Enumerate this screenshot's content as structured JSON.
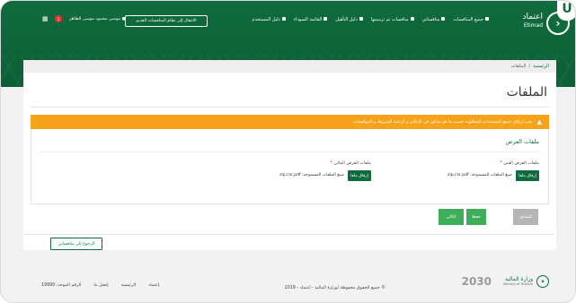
{
  "corner_badge": "U",
  "header": {
    "brand_ar": "اعتماد",
    "brand_en": "Etimad",
    "nav": [
      "جميع المنافسات",
      "منافساتي",
      "منافسات تم ترسيتها",
      "دليل التأهيل",
      "القائمة السوداء",
      "دليل المستخدم"
    ],
    "old_system_button": "الانتقال إلى نظام المنافسات القديم",
    "user_name": "موسى محمود موسى الظاهر",
    "notification_count": "1",
    "grid_icon": "grid-icon"
  },
  "breadcrumb": {
    "home": "الرئيسية",
    "separator": "/",
    "current": "الملفات"
  },
  "page_title": "الملفات",
  "alert": {
    "text": "يجب إرفاق جميع المستندات المطلوبة حسب ما هو مذكور في الإعلان و كراسة الشروط و المواصفات"
  },
  "panel": {
    "title": "ملفات العرض",
    "technical_label": "ملفات العرض الفني",
    "financial_label": "ملفات العرض المالي",
    "required_mark": "*",
    "attach_label": "إرفاق ملفا",
    "allowed_types": "صيغ الملفات المسموحة: zip,rar,pdf"
  },
  "wizard": {
    "prev": "السابق",
    "save": "حفظ",
    "next": "التالي"
  },
  "back_button": "الرجوع إلى منافساتي",
  "footer": {
    "ministry_ar": "وزارة المالية",
    "ministry_en": "Ministry of Finance",
    "vision": "2030",
    "copyright": "© جميع الحقوق محفوظة لوزارة المالية - اعتماد - 2019",
    "links": [
      "إعتماد",
      "الرئيسية",
      "إتصل بنا",
      "الرقم الموحد: 19990"
    ]
  },
  "colors": {
    "primary_green": "#0f6b3d",
    "warning_orange": "#f7a21b",
    "disabled_grey": "#b5b5b5",
    "next_green": "#3fae5a"
  }
}
